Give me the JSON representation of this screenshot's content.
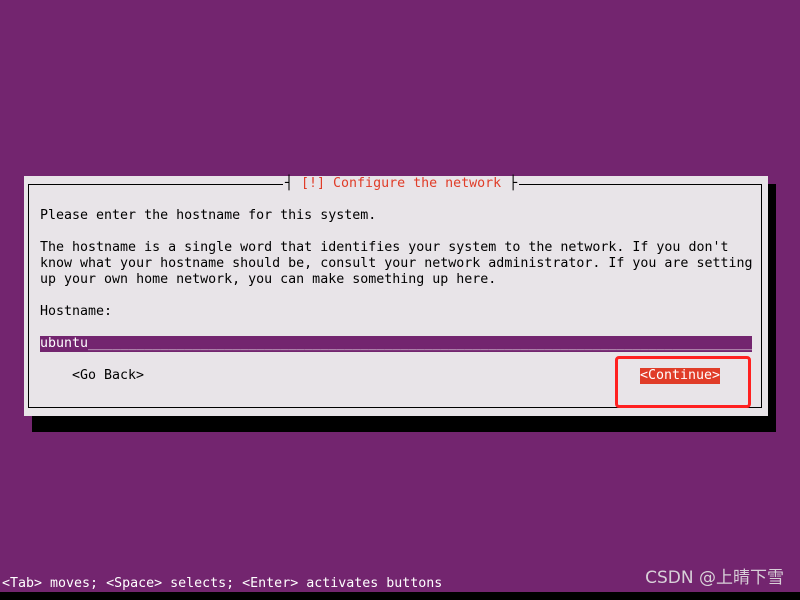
{
  "dialog": {
    "title": "[!] Configure the network",
    "prompt": "Please enter the hostname for this system.",
    "description": [
      "The hostname is a single word that identifies your system to the network. If you don't",
      "know what your hostname should be, consult your network administrator. If you are setting",
      "up your own home network, you can make something up here."
    ],
    "field_label": "Hostname:",
    "hostname_value": "ubuntu",
    "go_back_label": "<Go Back>",
    "continue_label": "<Continue>"
  },
  "status_bar": "<Tab> moves; <Space> selects; <Enter> activates buttons",
  "watermark": "CSDN @上晴下雪",
  "colors": {
    "background": "#73256f",
    "dialog": "#e8e4e8",
    "accent": "#e03c28",
    "highlight": "#ff2020"
  }
}
